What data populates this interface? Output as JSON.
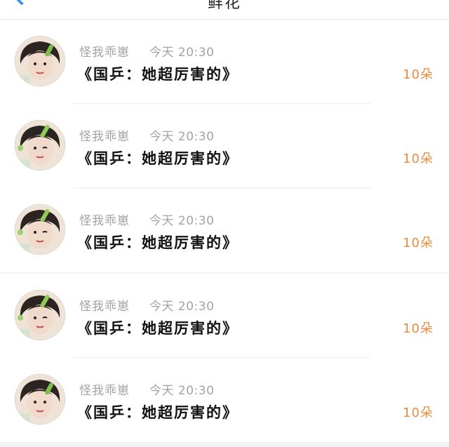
{
  "header": {
    "title": "鲜花"
  },
  "theme": {
    "accent": "#3b8ef0",
    "amount_color": "#ef8a3a",
    "muted_text": "#a3a3a3"
  },
  "records": [
    {
      "user": "怪我乖崽",
      "time": "今天 20:30",
      "title": "《国乒：她超厉害的》",
      "amount": "10朵"
    },
    {
      "user": "怪我乖崽",
      "time": "今天 20:30",
      "title": "《国乒：她超厉害的》",
      "amount": "10朵"
    },
    {
      "user": "怪我乖崽",
      "time": "今天 20:30",
      "title": "《国乒：她超厉害的》",
      "amount": "10朵"
    },
    {
      "user": "怪我乖崽",
      "time": "今天 20:30",
      "title": "《国乒：她超厉害的》",
      "amount": "10朵"
    },
    {
      "user": "怪我乖崽",
      "time": "今天 20:30",
      "title": "《国乒：她超厉害的》",
      "amount": "10朵"
    }
  ]
}
